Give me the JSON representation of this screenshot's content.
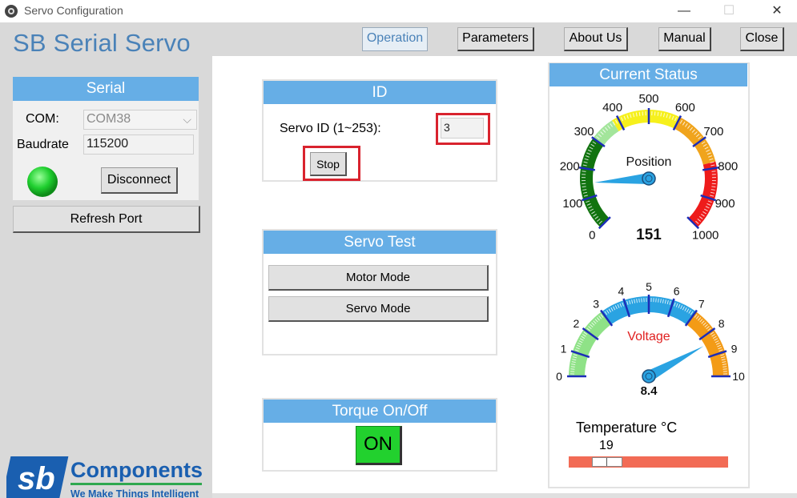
{
  "window": {
    "title": "Servo Configuration",
    "minimize": "—",
    "maximize": "☐",
    "close": "✕"
  },
  "app": {
    "brand": "SB Serial Servo"
  },
  "nav": {
    "operation": "Operation",
    "parameters": "Parameters",
    "about": "About Us",
    "manual": "Manual",
    "close": "Close"
  },
  "serial": {
    "heading": "Serial",
    "com_label": "COM:",
    "com_value": "COM38",
    "baud_label": "Baudrate",
    "baud_value": "115200",
    "disconnect": "Disconnect",
    "refresh": "Refresh Port",
    "status_color": "#1fcf2f"
  },
  "id_section": {
    "heading": "ID",
    "servo_id_label": "Servo ID (1~253):",
    "servo_id_value": "3",
    "stop": "Stop"
  },
  "servo_test": {
    "heading": "Servo Test",
    "motor_mode": "Motor Mode",
    "servo_mode": "Servo Mode"
  },
  "torque": {
    "heading": "Torque On/Off",
    "state": "ON"
  },
  "status": {
    "heading": "Current Status",
    "position": {
      "label": "Position",
      "value": 151,
      "display": "151",
      "ticks": [
        "0",
        "100",
        "200",
        "300",
        "400",
        "500",
        "600",
        "700",
        "800",
        "900",
        "1000"
      ]
    },
    "voltage": {
      "label": "Voltage",
      "value": 8.4,
      "display": "8.4",
      "ticks": [
        "0",
        "1",
        "2",
        "3",
        "4",
        "5",
        "6",
        "7",
        "8",
        "9",
        "10"
      ]
    },
    "temperature": {
      "label": "Temperature °C",
      "value": "19"
    }
  },
  "logo": {
    "letters": "sb",
    "name": "Components",
    "tagline": "We Make Things Intelligent"
  }
}
